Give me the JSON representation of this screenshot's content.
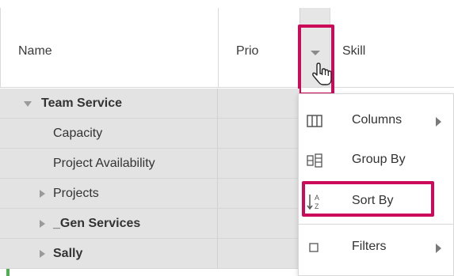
{
  "columns": {
    "name": "Name",
    "prio": "Prio",
    "skill": "Skill"
  },
  "rows": [
    {
      "label": "Team Service",
      "bold": true,
      "expander": "expanded"
    },
    {
      "label": "Capacity",
      "bold": false,
      "expander": "none"
    },
    {
      "label": "Project Availability",
      "bold": false,
      "expander": "none"
    },
    {
      "label": "Projects",
      "bold": false,
      "expander": "collapsed"
    },
    {
      "label": "_Gen Services",
      "bold": true,
      "expander": "collapsed"
    },
    {
      "label": "Sally",
      "bold": true,
      "expander": "collapsed"
    }
  ],
  "menu": {
    "items": [
      {
        "label": "Columns",
        "icon": "columns-icon",
        "submenu": true
      },
      {
        "label": "Group By",
        "icon": "group-by-icon",
        "submenu": false
      },
      {
        "label": "Sort By",
        "icon": "sort-az-icon",
        "submenu": false
      },
      {
        "label": "Filters",
        "icon": "checkbox-icon",
        "submenu": true
      }
    ]
  },
  "colors": {
    "highlight": "#cc0a5a",
    "group_bar": "#4caf50",
    "row_bg": "#e3e3e3"
  }
}
